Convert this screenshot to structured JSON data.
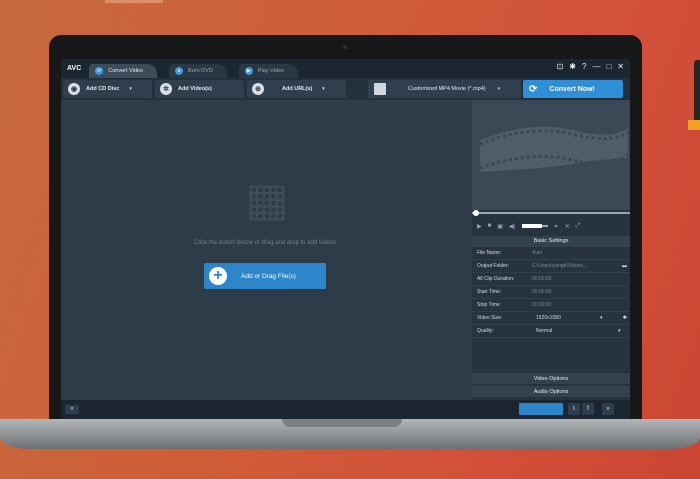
{
  "app": {
    "logo": "AVC"
  },
  "tabs": [
    {
      "label": "Convert Video",
      "icon": "convert-icon",
      "active": true
    },
    {
      "label": "Burn DVD",
      "icon": "disc-icon",
      "active": false
    },
    {
      "label": "Play Video",
      "icon": "play-icon",
      "active": false
    }
  ],
  "toolbar": {
    "add_cd": "Add CD Disc",
    "add_video": "Add Video(s)",
    "add_url": "Add URL(s)",
    "format": "Customized MP4 Movie (*.mp4)",
    "convert": "Convert Now!"
  },
  "main": {
    "hint": "Click the button below or drag and drop to add videos.",
    "add_button": "Add or Drag File(s)"
  },
  "settings": {
    "header": "Basic Settings",
    "file_name_label": "File Name:",
    "file_name": "Auto",
    "output_label": "Output Folder:",
    "output": "C:\\Users\\yangh\\Videos...",
    "duration_label": "All Clip Duration:",
    "duration": "00:00:00",
    "start_label": "Start Time:",
    "start": "00:00:00",
    "stop_label": "Stop Time:",
    "stop": "00:00:00",
    "size_label": "Video Size:",
    "size": "1920x1080",
    "quality_label": "Quality:",
    "quality": "Normal",
    "video_options": "Video Options",
    "audio_options": "Audio Options"
  },
  "colors": {
    "accent": "#2f8fd6",
    "background": "#2e3b48",
    "titlebar": "#1b2631"
  }
}
